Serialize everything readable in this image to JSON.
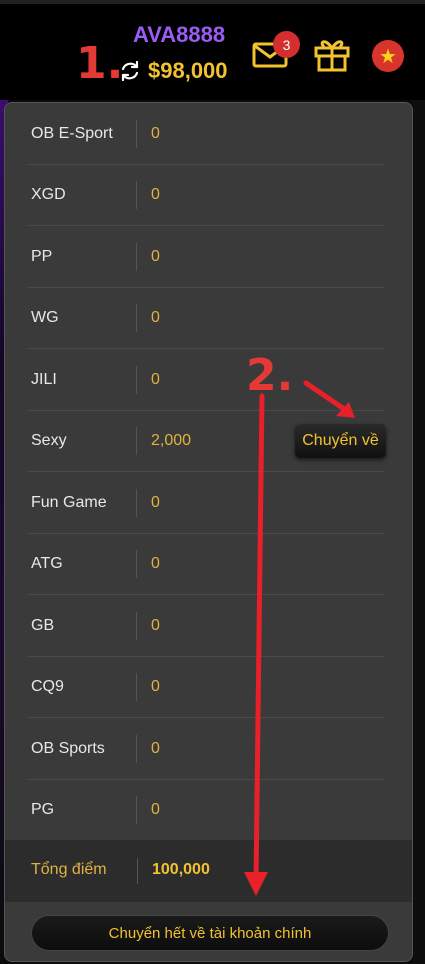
{
  "header": {
    "username": "AVA8888",
    "balance": "$98,000",
    "mail_badge": "3",
    "flag_star": "★"
  },
  "annotations": {
    "step1": "1.",
    "step2": "2."
  },
  "wallets": [
    {
      "name": "OB E-Sport",
      "value": "0"
    },
    {
      "name": "XGD",
      "value": "0"
    },
    {
      "name": "PP",
      "value": "0"
    },
    {
      "name": "WG",
      "value": "0"
    },
    {
      "name": "JILI",
      "value": "0"
    },
    {
      "name": "Sexy",
      "value": "2,000"
    },
    {
      "name": "Fun Game",
      "value": "0"
    },
    {
      "name": "ATG",
      "value": "0"
    },
    {
      "name": "GB",
      "value": "0"
    },
    {
      "name": "CQ9",
      "value": "0"
    },
    {
      "name": "OB Sports",
      "value": "0"
    },
    {
      "name": "PG",
      "value": "0"
    }
  ],
  "transfer_button": "Chuyển về",
  "total": {
    "label": "Tổng điểm",
    "value": "100,000"
  },
  "transfer_all_button": "Chuyển hết về tài khoản chính",
  "colors": {
    "accent_gold": "#f2c230",
    "username_purple": "#9b5cf6",
    "annotation_red": "#e53935"
  }
}
